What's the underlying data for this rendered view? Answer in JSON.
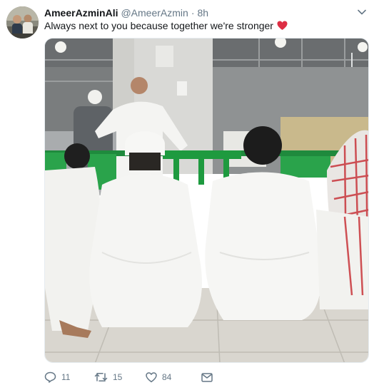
{
  "tweet": {
    "display_name": "AmeerAzminAli",
    "handle": "@AmeerAzmin",
    "separator": "·",
    "time": "8h",
    "text": "Always next to you because together we're stronger",
    "emoji": "red-heart"
  },
  "actions": {
    "reply_count": "11",
    "retweet_count": "15",
    "like_count": "84"
  },
  "icons": {
    "reply": "reply-icon",
    "retweet": "retweet-icon",
    "like": "heart-outline-icon",
    "message": "envelope-icon",
    "menu": "chevron-down-icon"
  },
  "colors": {
    "icon_gray": "#657786",
    "text": "#14171a",
    "heart": "#e0245e"
  }
}
